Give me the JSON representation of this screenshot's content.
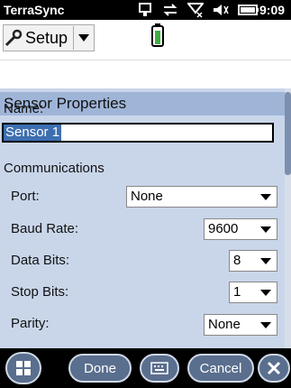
{
  "statusbar": {
    "app_name": "TerraSync",
    "time": "9:09",
    "icons": [
      "network-icon",
      "sync-icon",
      "signal-icon",
      "volume-icon",
      "battery-icon"
    ]
  },
  "toolbar": {
    "setup_label": "Setup",
    "icon": "wrench-icon",
    "battery_icon": "battery-icon"
  },
  "panel": {
    "title": "Sensor Properties",
    "name_label": "Name:",
    "name_value": "Sensor 1",
    "communications_label": "Communications",
    "fields": [
      {
        "label": "Port:",
        "value": "None"
      },
      {
        "label": "Baud Rate:",
        "value": "9600"
      },
      {
        "label": "Data Bits:",
        "value": "8"
      },
      {
        "label": "Stop Bits:",
        "value": "1"
      },
      {
        "label": "Parity:",
        "value": "None"
      }
    ]
  },
  "bottombar": {
    "start_icon": "windows-icon",
    "done_label": "Done",
    "keyboard_icon": "keyboard-icon",
    "cancel_label": "Cancel",
    "close_icon": "close-icon"
  },
  "colors": {
    "panel_bg": "#c9d6ea",
    "title_bg": "#9fb5d8",
    "selection": "#3d6fb0"
  }
}
